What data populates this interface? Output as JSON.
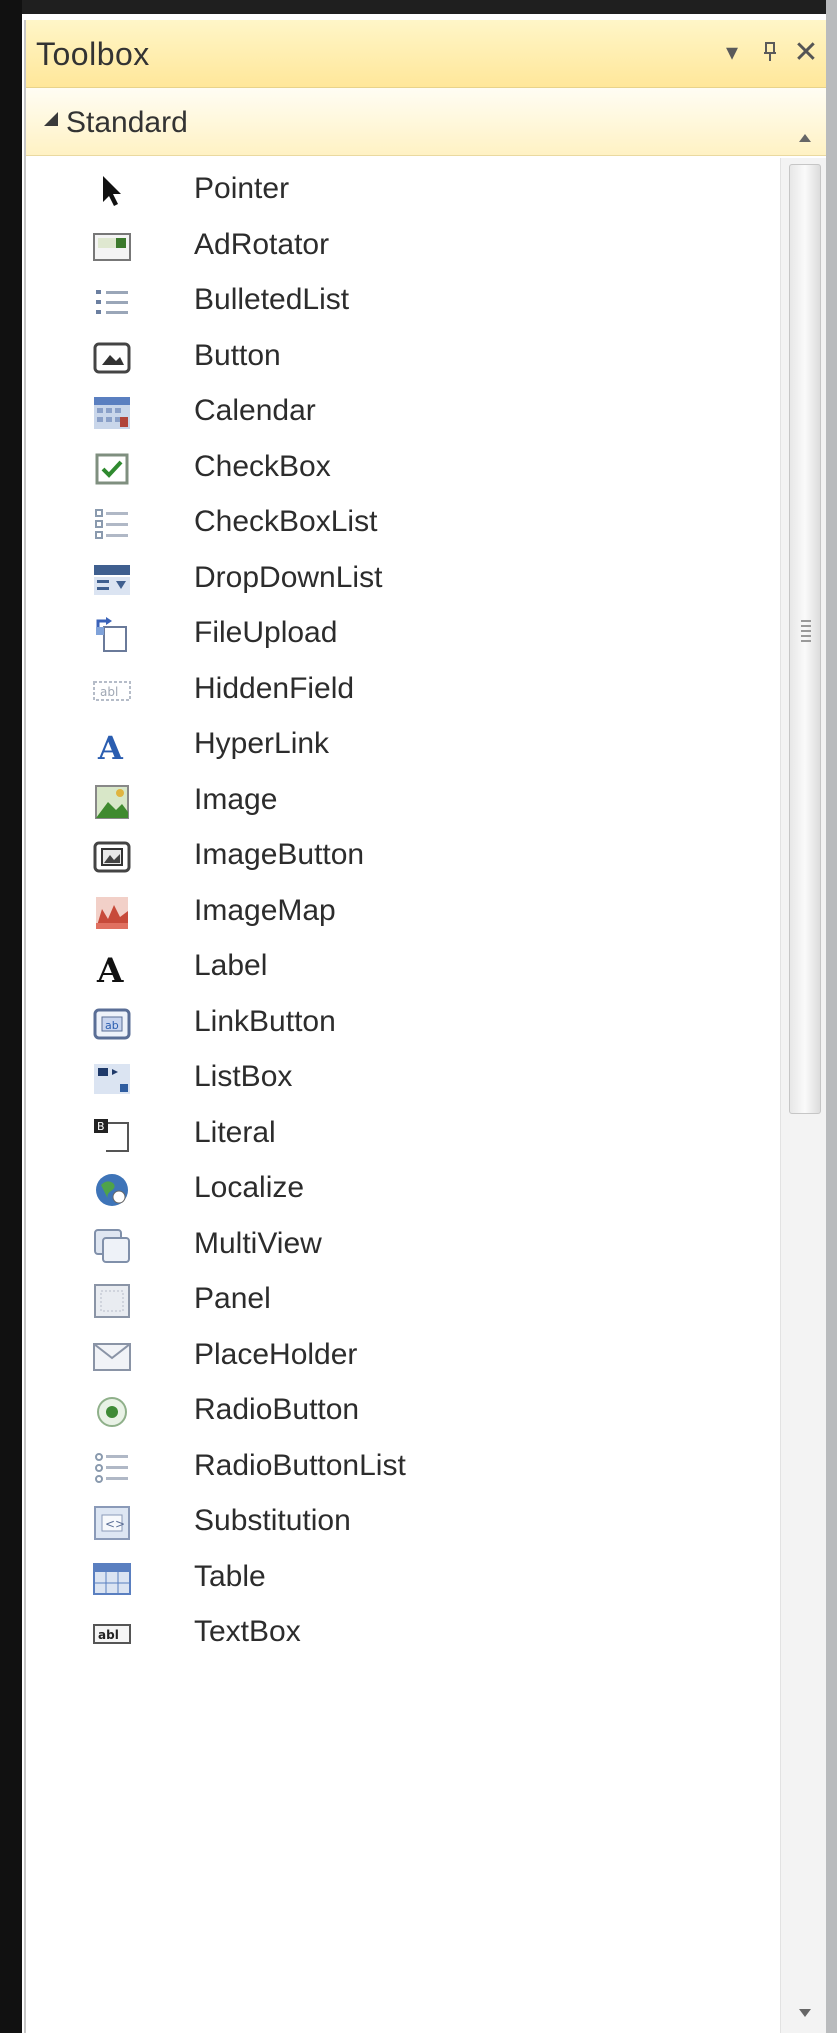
{
  "window": {
    "title": "Toolbox",
    "dropdown_glyph": "▾",
    "pin_glyph": "⊕",
    "close_glyph": "✕"
  },
  "section": {
    "label": "Standard"
  },
  "items": [
    {
      "label": "Pointer",
      "icon": "pointer-icon"
    },
    {
      "label": "AdRotator",
      "icon": "adrotator-icon"
    },
    {
      "label": "BulletedList",
      "icon": "bulleted-list-icon"
    },
    {
      "label": "Button",
      "icon": "button-icon"
    },
    {
      "label": "Calendar",
      "icon": "calendar-icon"
    },
    {
      "label": "CheckBox",
      "icon": "checkbox-icon"
    },
    {
      "label": "CheckBoxList",
      "icon": "checkbox-list-icon"
    },
    {
      "label": "DropDownList",
      "icon": "dropdown-list-icon"
    },
    {
      "label": "FileUpload",
      "icon": "file-upload-icon"
    },
    {
      "label": "HiddenField",
      "icon": "hidden-field-icon"
    },
    {
      "label": "HyperLink",
      "icon": "hyperlink-icon"
    },
    {
      "label": "Image",
      "icon": "image-icon"
    },
    {
      "label": "ImageButton",
      "icon": "image-button-icon"
    },
    {
      "label": "ImageMap",
      "icon": "image-map-icon"
    },
    {
      "label": "Label",
      "icon": "label-icon"
    },
    {
      "label": "LinkButton",
      "icon": "link-button-icon"
    },
    {
      "label": "ListBox",
      "icon": "listbox-icon"
    },
    {
      "label": "Literal",
      "icon": "literal-icon"
    },
    {
      "label": "Localize",
      "icon": "localize-icon"
    },
    {
      "label": "MultiView",
      "icon": "multiview-icon"
    },
    {
      "label": "Panel",
      "icon": "panel-icon"
    },
    {
      "label": "PlaceHolder",
      "icon": "placeholder-icon"
    },
    {
      "label": "RadioButton",
      "icon": "radio-button-icon"
    },
    {
      "label": "RadioButtonList",
      "icon": "radio-button-list-icon"
    },
    {
      "label": "Substitution",
      "icon": "substitution-icon"
    },
    {
      "label": "Table",
      "icon": "table-icon"
    },
    {
      "label": "TextBox",
      "icon": "textbox-icon"
    }
  ]
}
